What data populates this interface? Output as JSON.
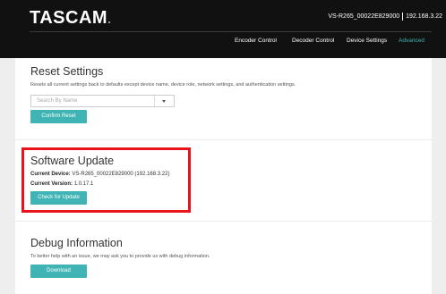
{
  "header": {
    "logo": "TASCAM",
    "logo_dot": ".",
    "device_name": "VS-R265_00022E829000",
    "device_ip": "192.168.3.22"
  },
  "nav": {
    "items": [
      {
        "label": "Encoder Control",
        "active": false
      },
      {
        "label": "Decoder Control",
        "active": false
      },
      {
        "label": "Device Settings",
        "active": false
      },
      {
        "label": "Advanced",
        "active": true
      }
    ]
  },
  "reset": {
    "title": "Reset Settings",
    "description": "Resets all current settings back to defaults except device name, device role, network settings, and authentication settings.",
    "search_placeholder": "Search By Name",
    "confirm_label": "Confirm Reset"
  },
  "software": {
    "title": "Software Update",
    "device_label": "Current Device:",
    "device_value": "VS-R265_00022E829000 (192.168.3.22)",
    "version_label": "Current Version:",
    "version_value": "1.0.17.1",
    "check_label": "Check for Update"
  },
  "debug": {
    "title": "Debug Information",
    "description": "To better help with an issue, we may ask you to provide us with debug information.",
    "download_label": "Download"
  },
  "colors": {
    "accent": "#40b4b4",
    "highlight": "#e8121c",
    "topbar": "#111111"
  }
}
